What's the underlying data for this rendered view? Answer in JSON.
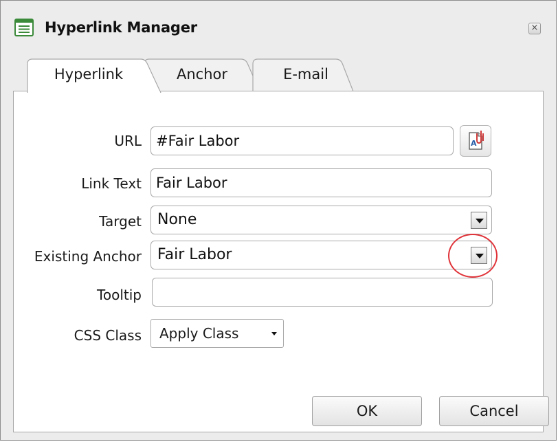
{
  "window": {
    "title": "Hyperlink Manager",
    "close_label": "×"
  },
  "tabs": [
    {
      "label": "Hyperlink",
      "active": true
    },
    {
      "label": "Anchor",
      "active": false
    },
    {
      "label": "E-mail",
      "active": false
    }
  ],
  "form": {
    "url": {
      "label": "URL",
      "value": "#Fair Labor"
    },
    "link_text": {
      "label": "Link Text",
      "value": "Fair Labor"
    },
    "target": {
      "label": "Target",
      "value": "None"
    },
    "existing_anchor": {
      "label": "Existing Anchor",
      "value": "Fair Labor"
    },
    "tooltip": {
      "label": "Tooltip",
      "value": ""
    },
    "css_class": {
      "label": "CSS Class",
      "value": "Apply Class"
    }
  },
  "buttons": {
    "ok": "OK",
    "cancel": "Cancel"
  },
  "icons": {
    "title": "document-list-icon",
    "document_manager": "document-paperclip-icon",
    "dropdown": "chevron-down-icon"
  },
  "colors": {
    "highlight": "#e0343a",
    "title_icon_green": "#3b8a3a",
    "paperclip_red": "#d23a3a"
  }
}
